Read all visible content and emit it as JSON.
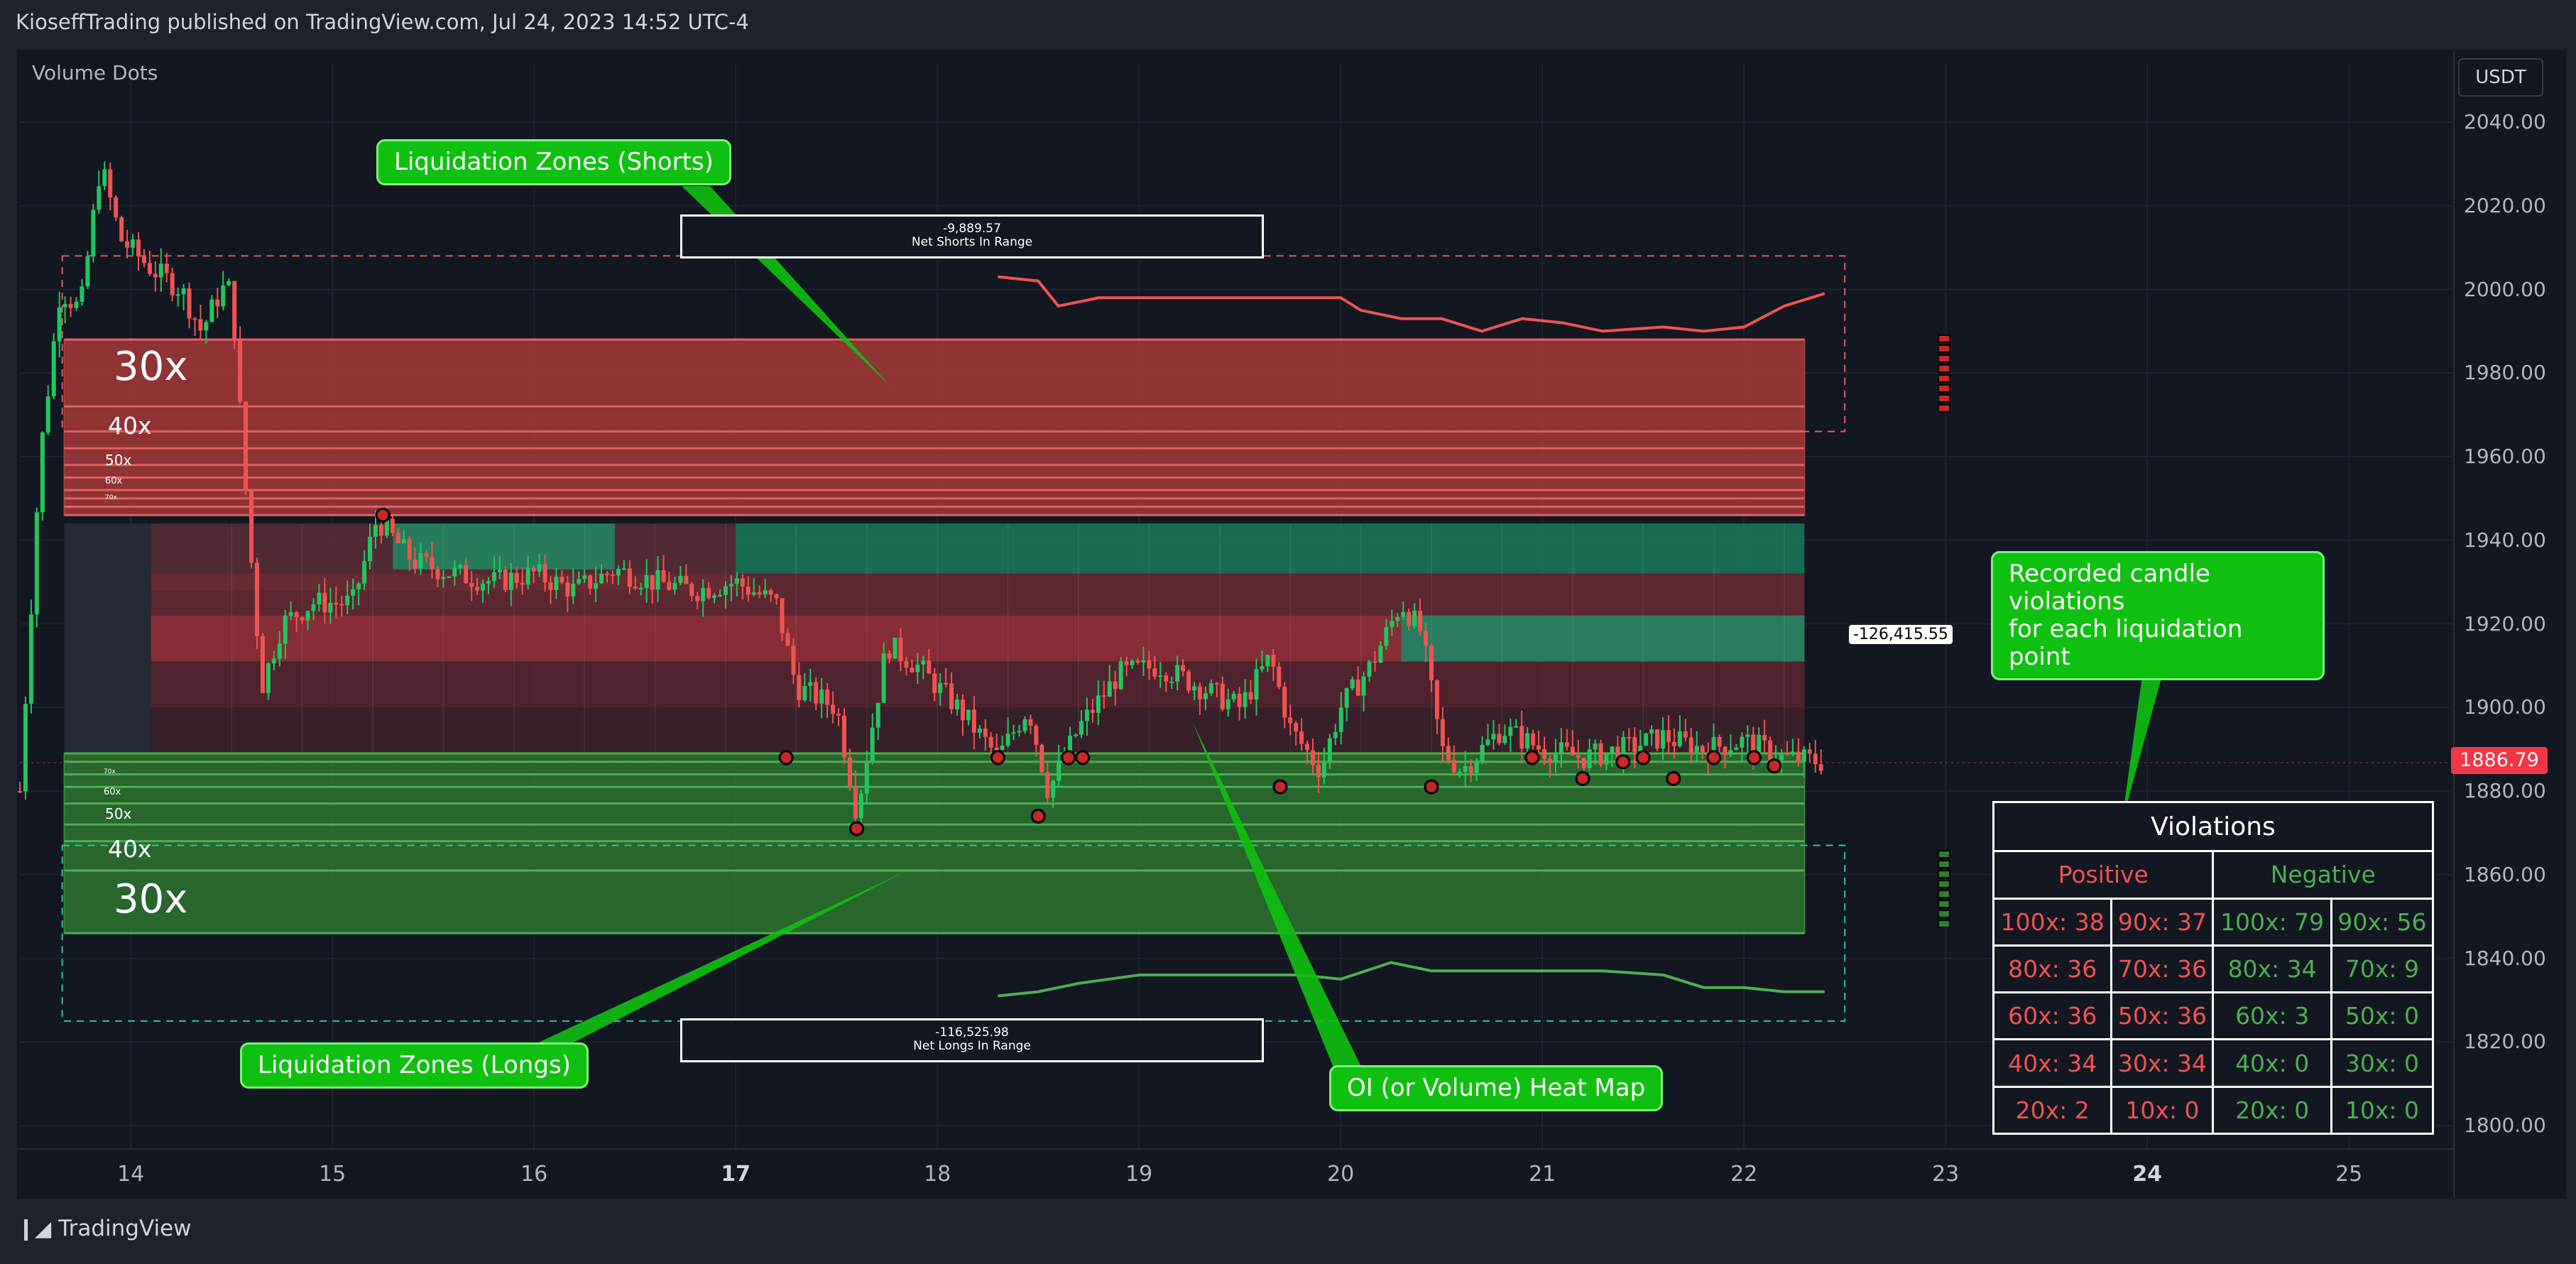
{
  "header": {
    "publisher": "KioseffTrading published on TradingView.com, Jul 24, 2023 14:52 UTC-4"
  },
  "indicator_label": "Volume Dots",
  "currency": "USDT",
  "last_price": "1886.79",
  "oi_value": "-126,415.55",
  "footer": {
    "brand": "TradingView"
  },
  "callouts": {
    "shorts": "Liquidation Zones (Shorts)",
    "longs": "Liquidation Zones (Longs)",
    "oi": "OI (or Volume) Heat Map",
    "violations_line1": "Recorded candle violations",
    "violations_line2": "for each liquidation point"
  },
  "net_shorts": {
    "value": "-9,889.57",
    "label": "Net Shorts In Range"
  },
  "net_longs": {
    "value": "-116,525.98",
    "label": "Net Longs In Range"
  },
  "leverage_labels": {
    "short": [
      "30x",
      "40x",
      "50x",
      "60x",
      "70x"
    ],
    "long": [
      "30x",
      "40x",
      "50x",
      "60x",
      "70x"
    ]
  },
  "violations": {
    "title": "Violations",
    "positive_header": "Positive",
    "negative_header": "Negative",
    "rows": [
      [
        "100x: 38",
        "90x: 37",
        "100x: 79",
        "90x: 56"
      ],
      [
        "80x: 36",
        "70x: 36",
        "80x: 34",
        "70x: 9"
      ],
      [
        "60x: 36",
        "50x: 36",
        "60x: 3",
        "50x: 0"
      ],
      [
        "40x: 34",
        "30x: 34",
        "40x: 0",
        "30x: 0"
      ],
      [
        "20x: 2",
        "10x: 0",
        "20x: 0",
        "10x: 0"
      ]
    ]
  },
  "colors": {
    "up": "#26a69a",
    "down": "#ef5350",
    "short_zone": "#b23b3b",
    "long_zone": "#2f7d32",
    "callout": "#10c010"
  },
  "chart_data": {
    "type": "candlestick",
    "y_ticks": [
      "2040.00",
      "2020.00",
      "2000.00",
      "1980.00",
      "1960.00",
      "1940.00",
      "1920.00",
      "1900.00",
      "1880.00",
      "1860.00",
      "1840.00",
      "1820.00",
      "1800.00"
    ],
    "x_ticks": [
      "14",
      "15",
      "16",
      "17",
      "18",
      "19",
      "20",
      "21",
      "22",
      "23",
      "24",
      "25"
    ],
    "bold_x_ticks": [
      "17",
      "24"
    ],
    "ylim": [
      1790,
      2050
    ],
    "x_domain": [
      13.45,
      25.5
    ],
    "price_path": [
      [
        13.45,
        1880
      ],
      [
        13.55,
        1960
      ],
      [
        13.65,
        2000
      ],
      [
        13.75,
        1995
      ],
      [
        13.85,
        2030
      ],
      [
        13.95,
        2012
      ],
      [
        14.1,
        2005
      ],
      [
        14.25,
        2000
      ],
      [
        14.35,
        1990
      ],
      [
        14.45,
        2000
      ],
      [
        14.5,
        2000
      ],
      [
        14.58,
        1945
      ],
      [
        14.65,
        1905
      ],
      [
        14.75,
        1920
      ],
      [
        14.9,
        1925
      ],
      [
        15.1,
        1925
      ],
      [
        15.22,
        1945
      ],
      [
        15.4,
        1935
      ],
      [
        15.6,
        1932
      ],
      [
        15.8,
        1930
      ],
      [
        16.0,
        1932
      ],
      [
        16.2,
        1928
      ],
      [
        16.4,
        1933
      ],
      [
        16.6,
        1930
      ],
      [
        16.8,
        1928
      ],
      [
        17.0,
        1930
      ],
      [
        17.2,
        1925
      ],
      [
        17.3,
        1905
      ],
      [
        17.5,
        1900
      ],
      [
        17.6,
        1875
      ],
      [
        17.75,
        1915
      ],
      [
        17.9,
        1910
      ],
      [
        18.1,
        1900
      ],
      [
        18.3,
        1888
      ],
      [
        18.45,
        1900
      ],
      [
        18.55,
        1880
      ],
      [
        18.7,
        1895
      ],
      [
        18.9,
        1908
      ],
      [
        19.1,
        1910
      ],
      [
        19.3,
        1905
      ],
      [
        19.5,
        1900
      ],
      [
        19.65,
        1912
      ],
      [
        19.75,
        1895
      ],
      [
        19.9,
        1885
      ],
      [
        20.0,
        1900
      ],
      [
        20.15,
        1910
      ],
      [
        20.3,
        1925
      ],
      [
        20.4,
        1918
      ],
      [
        20.5,
        1890
      ],
      [
        20.6,
        1885
      ],
      [
        20.8,
        1895
      ],
      [
        21.0,
        1890
      ],
      [
        21.2,
        1888
      ],
      [
        21.4,
        1890
      ],
      [
        21.6,
        1893
      ],
      [
        21.8,
        1890
      ],
      [
        22.0,
        1892
      ],
      [
        22.2,
        1888
      ],
      [
        22.4,
        1887
      ]
    ],
    "short_liq_line": [
      [
        18.3,
        2003
      ],
      [
        18.5,
        2002
      ],
      [
        18.6,
        1996
      ],
      [
        18.8,
        1998
      ],
      [
        19.0,
        1998
      ],
      [
        19.5,
        1998
      ],
      [
        20.0,
        1998
      ],
      [
        20.1,
        1995
      ],
      [
        20.3,
        1993
      ],
      [
        20.5,
        1993
      ],
      [
        20.7,
        1990
      ],
      [
        20.9,
        1993
      ],
      [
        21.1,
        1992
      ],
      [
        21.3,
        1990
      ],
      [
        21.6,
        1991
      ],
      [
        21.8,
        1990
      ],
      [
        22.0,
        1991
      ],
      [
        22.2,
        1996
      ],
      [
        22.4,
        1999
      ]
    ],
    "long_liq_line": [
      [
        18.3,
        1831
      ],
      [
        18.5,
        1832
      ],
      [
        18.7,
        1834
      ],
      [
        19.0,
        1836
      ],
      [
        19.4,
        1836
      ],
      [
        19.8,
        1836
      ],
      [
        20.0,
        1835
      ],
      [
        20.25,
        1839
      ],
      [
        20.45,
        1837
      ],
      [
        20.7,
        1837
      ],
      [
        21.0,
        1837
      ],
      [
        21.3,
        1837
      ],
      [
        21.6,
        1836
      ],
      [
        21.8,
        1833
      ],
      [
        22.0,
        1833
      ],
      [
        22.2,
        1832
      ],
      [
        22.4,
        1832
      ]
    ],
    "short_zone": {
      "x": [
        13.67,
        22.3
      ],
      "y": [
        1946,
        1988
      ],
      "levels": [
        1988,
        1972,
        1966,
        1962,
        1958,
        1955,
        1952,
        1950,
        1948,
        1946
      ]
    },
    "long_zone": {
      "x": [
        13.67,
        22.3
      ],
      "y": [
        1846,
        1889
      ],
      "levels": [
        1889,
        1887,
        1884,
        1881,
        1877,
        1872,
        1868,
        1861,
        1846
      ]
    },
    "short_range_box": {
      "x": [
        13.66,
        22.5
      ],
      "y": [
        1966,
        2008
      ]
    },
    "long_range_box": {
      "x": [
        13.66,
        22.5
      ],
      "y": [
        1825,
        1867
      ]
    },
    "heat_bands": [
      {
        "x": [
          14.1,
          17.0
        ],
        "y": [
          1928,
          1944
        ],
        "c": "#5a2e35"
      },
      {
        "x": [
          17.0,
          22.3
        ],
        "y": [
          1932,
          1944
        ],
        "c": "#1a7a5a"
      },
      {
        "x": [
          15.3,
          16.4
        ],
        "y": [
          1933,
          1944
        ],
        "c": "#1e8a62"
      },
      {
        "x": [
          14.1,
          22.3
        ],
        "y": [
          1922,
          1932
        ],
        "c": "#6a2a32"
      },
      {
        "x": [
          14.1,
          22.3
        ],
        "y": [
          1911,
          1922
        ],
        "c": "#9a3038"
      },
      {
        "x": [
          20.3,
          22.3
        ],
        "y": [
          1911,
          1922
        ],
        "c": "#1a8a66"
      },
      {
        "x": [
          14.1,
          22.3
        ],
        "y": [
          1900,
          1911
        ],
        "c": "#5a2630"
      },
      {
        "x": [
          14.1,
          22.3
        ],
        "y": [
          1889,
          1900
        ],
        "c": "#3e222a"
      },
      {
        "x": [
          13.67,
          14.1
        ],
        "y": [
          1889,
          1944
        ],
        "c": "#2a2e39"
      }
    ],
    "violation_dots": [
      [
        15.25,
        1946
      ],
      [
        17.25,
        1888
      ],
      [
        17.6,
        1871
      ],
      [
        18.3,
        1888
      ],
      [
        18.5,
        1874
      ],
      [
        18.65,
        1888
      ],
      [
        18.72,
        1888
      ],
      [
        19.7,
        1881
      ],
      [
        20.45,
        1881
      ],
      [
        20.95,
        1888
      ],
      [
        21.2,
        1883
      ],
      [
        21.4,
        1887
      ],
      [
        21.5,
        1888
      ],
      [
        21.65,
        1883
      ],
      [
        21.85,
        1888
      ],
      [
        22.05,
        1888
      ],
      [
        22.15,
        1886
      ]
    ]
  }
}
